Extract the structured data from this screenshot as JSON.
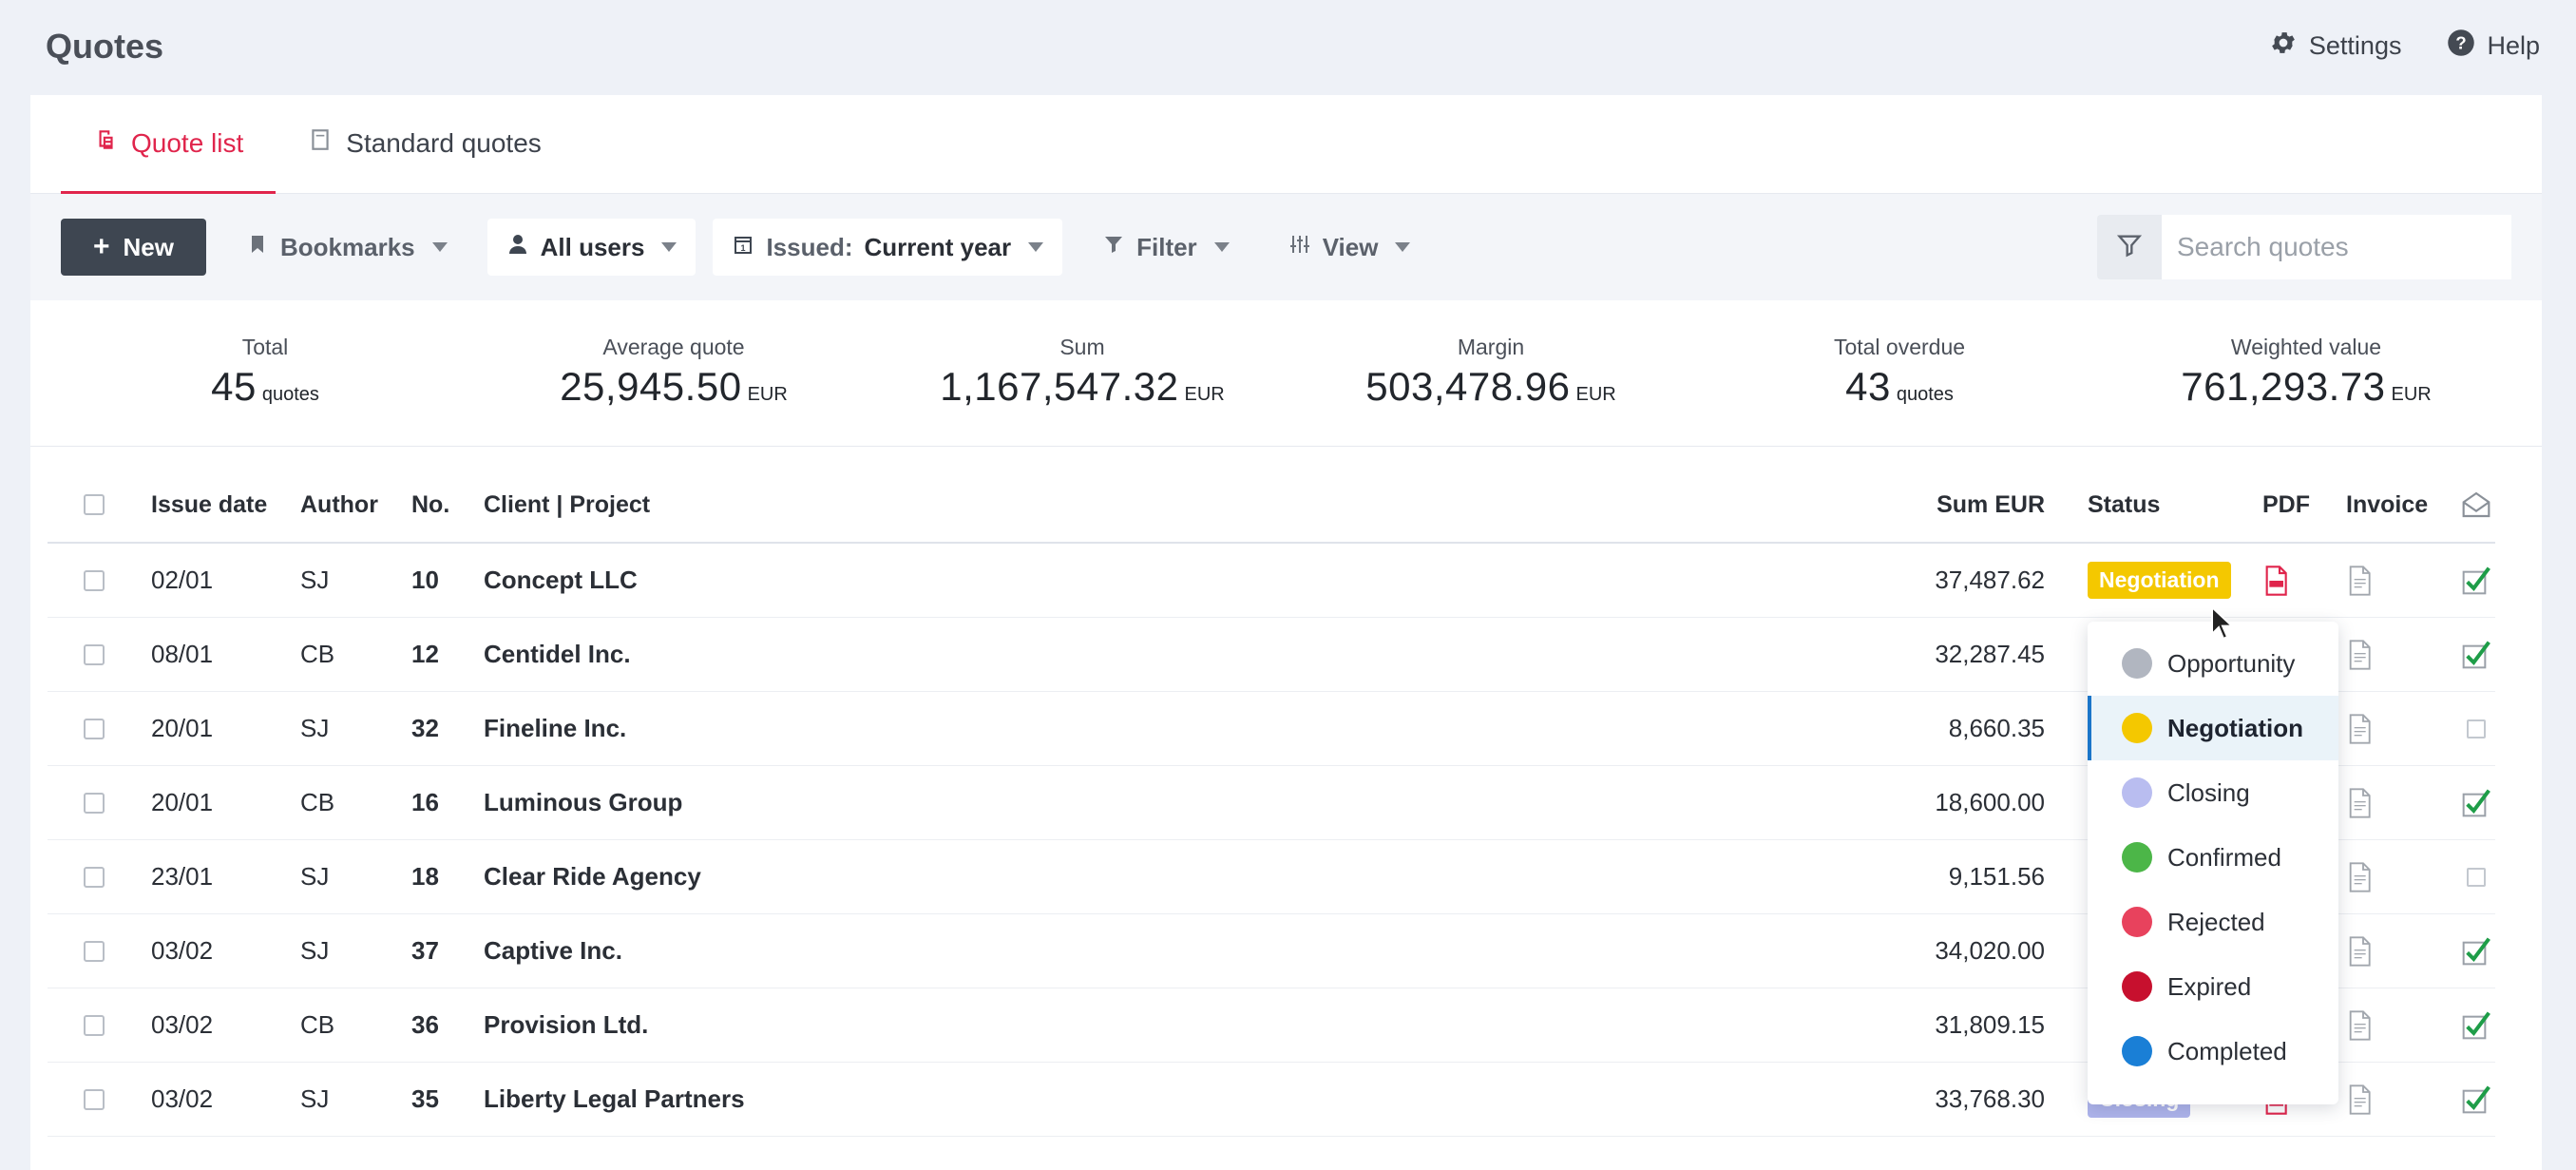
{
  "header": {
    "title": "Quotes",
    "settings_label": "Settings",
    "help_label": "Help"
  },
  "tabs": [
    {
      "label": "Quote list",
      "active": true
    },
    {
      "label": "Standard quotes",
      "active": false
    }
  ],
  "toolbar": {
    "new_label": "New",
    "bookmarks_label": "Bookmarks",
    "users_label": "All users",
    "issued_prefix": "Issued:",
    "issued_value": "Current year",
    "filter_label": "Filter",
    "view_label": "View",
    "search_placeholder": "Search quotes"
  },
  "stats": [
    {
      "label": "Total",
      "value": "45",
      "unit": "quotes"
    },
    {
      "label": "Average quote",
      "value": "25,945.50",
      "unit": "EUR"
    },
    {
      "label": "Sum",
      "value": "1,167,547.32",
      "unit": "EUR"
    },
    {
      "label": "Margin",
      "value": "503,478.96",
      "unit": "EUR"
    },
    {
      "label": "Total overdue",
      "value": "43",
      "unit": "quotes"
    },
    {
      "label": "Weighted value",
      "value": "761,293.73",
      "unit": "EUR"
    }
  ],
  "table": {
    "columns": {
      "issue_date": "Issue date",
      "author": "Author",
      "no": "No.",
      "client_project": "Client | Project",
      "sum": "Sum EUR",
      "status": "Status",
      "pdf": "PDF",
      "invoice": "Invoice"
    },
    "rows": [
      {
        "date": "02/01",
        "author": "SJ",
        "no": "10",
        "client": "Concept LLC",
        "sum": "37,487.62",
        "status": "Negotiation",
        "mail_sent": true
      },
      {
        "date": "08/01",
        "author": "CB",
        "no": "12",
        "client": "Centidel Inc.",
        "sum": "32,287.45",
        "status": "",
        "mail_sent": true
      },
      {
        "date": "20/01",
        "author": "SJ",
        "no": "32",
        "client": "Fineline Inc.",
        "sum": "8,660.35",
        "status": "",
        "mail_sent": false
      },
      {
        "date": "20/01",
        "author": "CB",
        "no": "16",
        "client": "Luminous Group",
        "sum": "18,600.00",
        "status": "",
        "mail_sent": true
      },
      {
        "date": "23/01",
        "author": "SJ",
        "no": "18",
        "client": "Clear Ride Agency",
        "sum": "9,151.56",
        "status": "",
        "mail_sent": false
      },
      {
        "date": "03/02",
        "author": "SJ",
        "no": "37",
        "client": "Captive Inc.",
        "sum": "34,020.00",
        "status": "",
        "mail_sent": true
      },
      {
        "date": "03/02",
        "author": "CB",
        "no": "36",
        "client": "Provision Ltd.",
        "sum": "31,809.15",
        "status": "",
        "mail_sent": true
      },
      {
        "date": "03/02",
        "author": "SJ",
        "no": "35",
        "client": "Liberty Legal Partners",
        "sum": "33,768.30",
        "status": "Closing",
        "mail_sent": true
      }
    ]
  },
  "status_dropdown": {
    "selected": "Negotiation",
    "options": [
      {
        "label": "Opportunity",
        "color": "#b1b6c0"
      },
      {
        "label": "Negotiation",
        "color": "#f4c800"
      },
      {
        "label": "Closing",
        "color": "#b9bdf0"
      },
      {
        "label": "Confirmed",
        "color": "#4cb648"
      },
      {
        "label": "Rejected",
        "color": "#e8425d"
      },
      {
        "label": "Expired",
        "color": "#c7102e"
      },
      {
        "label": "Completed",
        "color": "#1a7fd6"
      }
    ]
  },
  "colors": {
    "accent": "#e0254c",
    "negotiation_badge": "#f4c800",
    "closing_badge": "#aeb4ec",
    "check_green": "#1e9d48"
  }
}
